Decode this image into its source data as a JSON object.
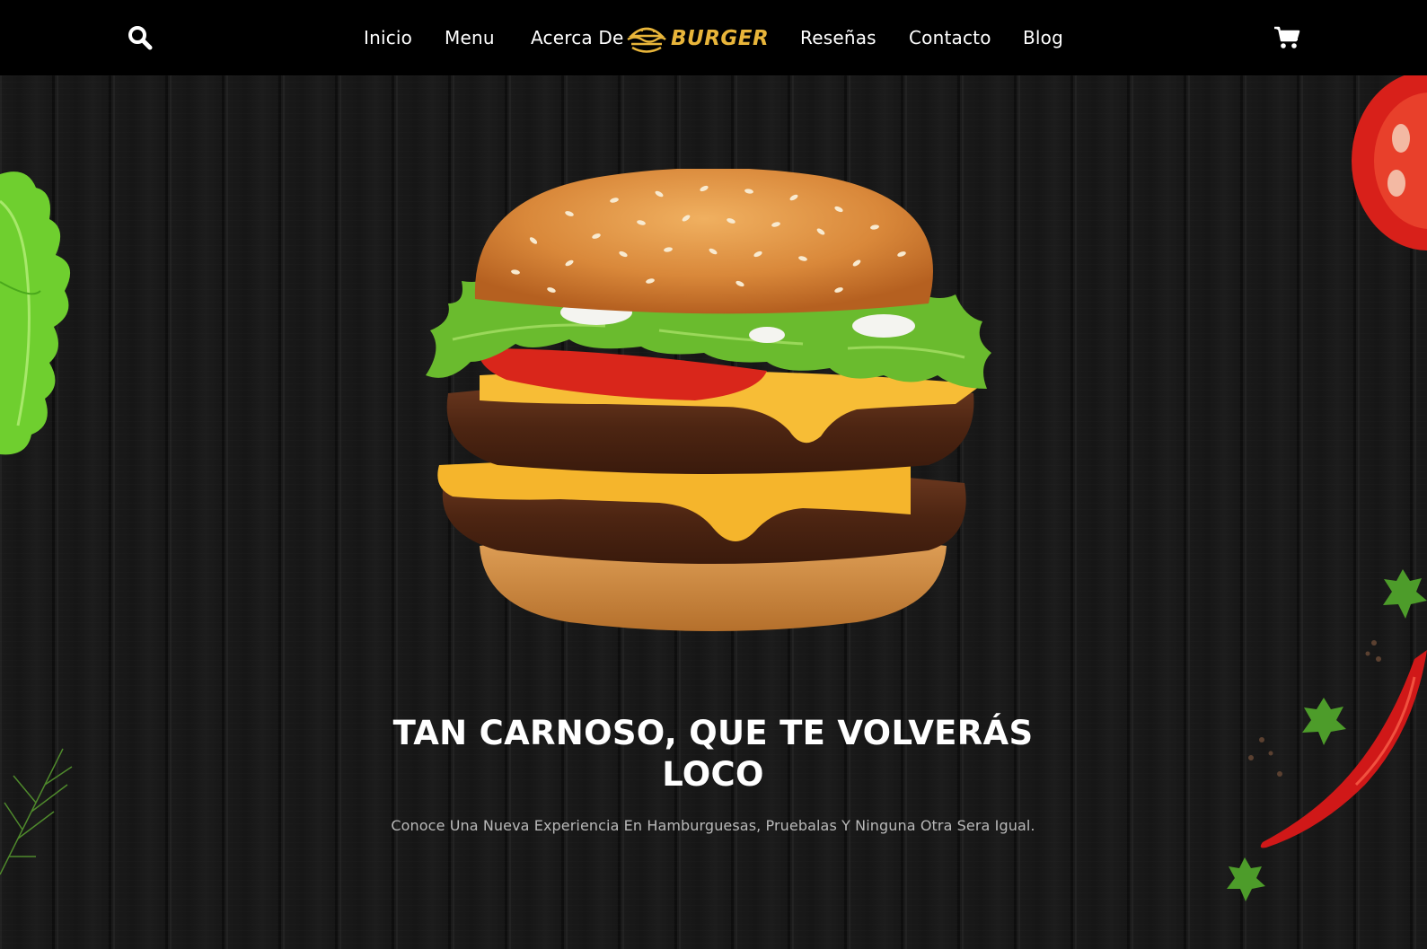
{
  "nav": {
    "links": [
      {
        "label": "Inicio"
      },
      {
        "label": "Menu"
      },
      {
        "label": "Acerca De"
      },
      {
        "label": "Reseñas"
      },
      {
        "label": "Contacto"
      },
      {
        "label": "Blog"
      }
    ],
    "logo_text": "BURGER",
    "search_icon": "search-icon",
    "cart_icon": "cart-icon"
  },
  "hero": {
    "headline_line1": "TAN CARNOSO, QUE TE VOLVERÁS",
    "headline_line2": "LOCO",
    "subtitle": "Conoce Una Nueva Experiencia En Hamburguesas, Pruebalas Y Ninguna Otra Sera Igual."
  },
  "colors": {
    "navbar_bg": "#000000",
    "hero_bg": "#171717",
    "logo_gold": "#e8b53a",
    "text_white": "#ffffff",
    "subtitle_gray": "#b9b9b9"
  }
}
